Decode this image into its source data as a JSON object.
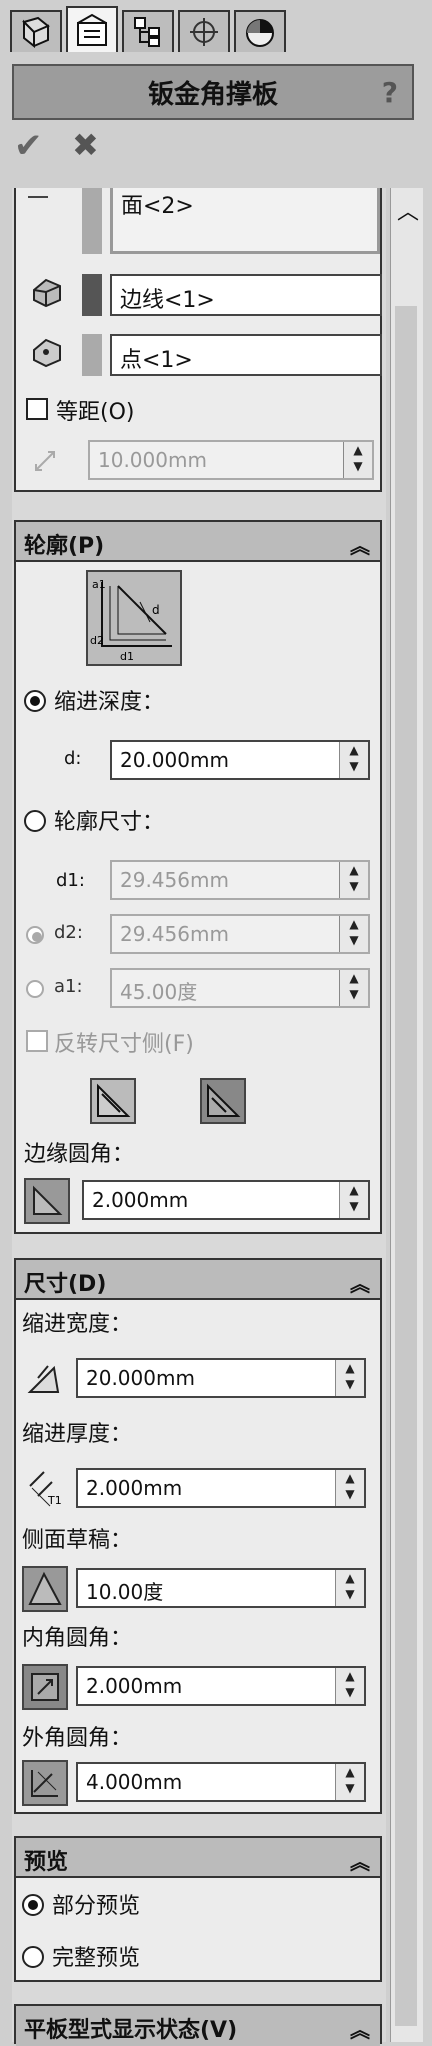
{
  "tabs": [
    {
      "name": "featuremanager-tab",
      "icon": "feature-tree-icon"
    },
    {
      "name": "propertymanager-tab",
      "icon": "property-manager-icon"
    },
    {
      "name": "configuration-tab",
      "icon": "configuration-icon"
    },
    {
      "name": "dimxpert-tab",
      "icon": "crosshair-icon"
    },
    {
      "name": "display-tab",
      "icon": "display-pie-icon"
    }
  ],
  "panel": {
    "title": "钣金角撑板",
    "help": "?"
  },
  "actions": {
    "ok": "✔",
    "cancel": "✖"
  },
  "position": {
    "face_value": "面<2>",
    "edge_value": "边线<1>",
    "point_value": "点<1>",
    "offset_label": "等距(O)",
    "offset_value": "10.000mm"
  },
  "profile": {
    "header": "轮廓(P)",
    "indent_depth_label": "缩进深度：",
    "d_label": "d:",
    "d_value": "20.000mm",
    "profile_dim_label": "轮廓尺寸：",
    "d1_label": "d1:",
    "d1_value": "29.456mm",
    "d2_label": "d2:",
    "d2_value": "29.456mm",
    "a1_label": "a1:",
    "a1_value": "45.00度",
    "flip_label": "反转尺寸侧(F)",
    "fillet_label": "边缘圆角：",
    "fillet_value": "2.000mm",
    "diagram_labels": {
      "a1": "a1",
      "d": "d",
      "d2": "d2",
      "d1": "d1"
    }
  },
  "dimensions": {
    "header": "尺寸(D)",
    "indent_width_label": "缩进宽度：",
    "indent_width_value": "20.000mm",
    "indent_thick_label": "缩进厚度：",
    "indent_thick_value": "2.000mm",
    "t1_label": "T1",
    "side_draft_label": "侧面草稿：",
    "side_draft_value": "10.00度",
    "inner_fillet_label": "内角圆角：",
    "inner_fillet_value": "2.000mm",
    "outer_fillet_label": "外角圆角：",
    "outer_fillet_value": "4.000mm"
  },
  "preview": {
    "header": "预览",
    "partial_label": "部分预览",
    "full_label": "完整预览"
  },
  "flat_state": {
    "header": "平板型式显示状态(V)"
  }
}
